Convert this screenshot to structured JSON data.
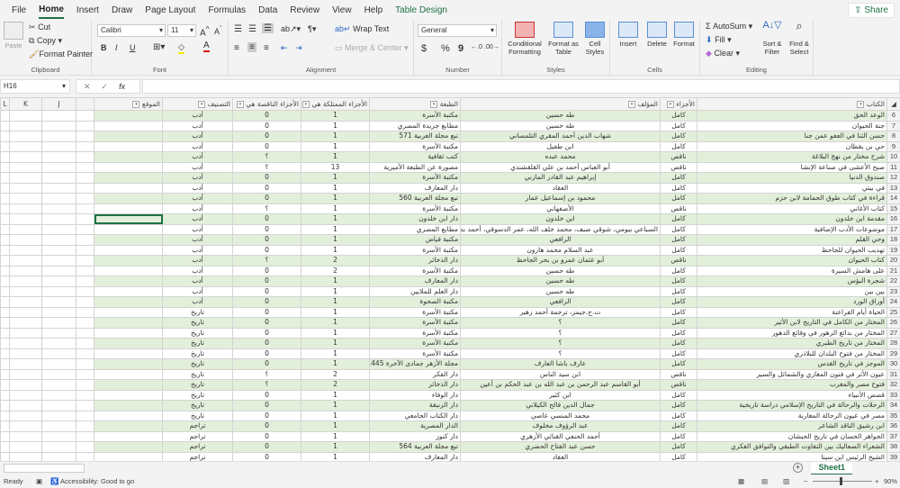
{
  "menu": {
    "tabs": [
      "File",
      "Home",
      "Insert",
      "Draw",
      "Page Layout",
      "Formulas",
      "Data",
      "Review",
      "View",
      "Help",
      "Table Design"
    ],
    "share": "Share"
  },
  "ribbon": {
    "clipboard": {
      "paste": "Paste",
      "cut": "Cut",
      "copy": "Copy",
      "format_painter": "Format Painter",
      "label": "Clipboard"
    },
    "font": {
      "name": "Calibri",
      "size": "11",
      "bold": "B",
      "italic": "I",
      "underline": "U",
      "label": "Font"
    },
    "alignment": {
      "wrap": "Wrap Text",
      "merge": "Merge & Center",
      "label": "Alignment"
    },
    "number": {
      "format": "General",
      "currency": "$",
      "percent": "%",
      "comma": "9",
      "label": "Number"
    },
    "styles": {
      "conditional": "Conditional Formatting",
      "format_table": "Format as Table",
      "cell_styles": "Cell Styles",
      "label": "Styles"
    },
    "cells": {
      "insert": "Insert",
      "delete": "Delete",
      "format": "Format",
      "label": "Cells"
    },
    "editing": {
      "autosum": "AutoSum",
      "fill": "Fill",
      "clear": "Clear",
      "sort": "Sort & Filter",
      "find": "Find & Select",
      "label": "Editing"
    }
  },
  "formula_bar": {
    "name_box": "H16",
    "fx": "fx",
    "value": ""
  },
  "sheet": {
    "extra_cols": [
      "L",
      "K",
      "J"
    ],
    "headers": [
      "الكتاب",
      "الأجزاء",
      "المؤلف",
      "الطبعة",
      "الأجزاء الممتلكة هي",
      "الأجزاء الناقصة هي",
      "التصنيف",
      "الموقع"
    ],
    "selected_row": 16,
    "rows": [
      {
        "n": 6,
        "c": [
          "الوعد الحق",
          "كامل",
          "طه حسين",
          "مكتبة الأسرة",
          "1",
          "0",
          "أدب"
        ]
      },
      {
        "n": 7,
        "c": [
          "جنة الحيوان",
          "كامل",
          "طه حسين",
          "مطابع جريدة المصري",
          "1",
          "0",
          "أدب"
        ]
      },
      {
        "n": 8,
        "c": [
          "حسن الثنا في العفو عمن جنا",
          "كامل",
          "شهاب الدين أحمد المقري التلمساني",
          "تبع مجلة العربية 571",
          "1",
          "0",
          "أدب"
        ]
      },
      {
        "n": 9,
        "c": [
          "حي بن يقظان",
          "كامل",
          "ابن طفيل",
          "مكتبة الأسرة",
          "1",
          "0",
          "أدب"
        ]
      },
      {
        "n": 10,
        "c": [
          "شرح مختار من نهج البلاغة",
          "ناقص",
          "محمد عبده",
          "كتب ثقافية",
          "1",
          "؟",
          "أدب"
        ]
      },
      {
        "n": 11,
        "c": [
          "صبح الأعشى في صناعة الإنشا",
          "ناقص",
          "أبو العباس أحمد بن علي القلقشندي",
          "مصورة عن الطبعة الأميرية",
          "13",
          "؟",
          "أدب"
        ]
      },
      {
        "n": 12,
        "c": [
          "صندوق الدنيا",
          "كامل",
          "إبراهيم عبد القادر المازني",
          "مكتبة الأسرة",
          "1",
          "0",
          "أدب"
        ]
      },
      {
        "n": 13,
        "c": [
          "في بيتي",
          "كامل",
          "العقاد",
          "دار المعارف",
          "1",
          "0",
          "أدب"
        ]
      },
      {
        "n": 14,
        "c": [
          "قراءة في كتاب طوق الحمامة لابن حزم",
          "كامل",
          "محمود بن إسماعيل عمار",
          "تبع مجلة العربية 560",
          "1",
          "0",
          "أدب"
        ]
      },
      {
        "n": 15,
        "c": [
          "كتاب الأغاني",
          "ناقص",
          "الأصفهاني",
          "مكتبة الأسرة",
          "1",
          "؟",
          "أدب"
        ]
      },
      {
        "n": 16,
        "c": [
          "مقدمة ابن خلدون",
          "كامل",
          "ابن خلدون",
          "دار ابن خلدون",
          "1",
          "0",
          "أدب"
        ]
      },
      {
        "n": 17,
        "c": [
          "موضوعات الأدب الإضافية",
          "كامل",
          "السباعي بيومي، شوقي ضيف، محمد خلف الله، عمر الدسوقي، أحمد بدوي",
          "مطابع المصري",
          "1",
          "0",
          "أدب"
        ]
      },
      {
        "n": 18,
        "c": [
          "وحي القلم",
          "كامل",
          "الرافعي",
          "مكتبة فياض",
          "1",
          "0",
          "أدب"
        ]
      },
      {
        "n": 19,
        "c": [
          "تهذيب الحيوان للجاحظ",
          "كامل",
          "عبد السلام محمد هارون",
          "مكتبة الأسرة",
          "1",
          "0",
          "أدب"
        ]
      },
      {
        "n": 20,
        "c": [
          "كتاب الحيوان",
          "ناقص",
          "أبو عثمان عمرو بن بحر الجاحظ",
          "دار الذخائر",
          "2",
          "؟",
          "أدب"
        ]
      },
      {
        "n": 21,
        "c": [
          "على هامش السيرة",
          "كامل",
          "طه حسين",
          "مكتبة الأسرة",
          "2",
          "0",
          "أدب"
        ]
      },
      {
        "n": 22,
        "c": [
          "شجرة البؤس",
          "كامل",
          "طه حسين",
          "دار المعارف",
          "1",
          "0",
          "أدب"
        ]
      },
      {
        "n": 23,
        "c": [
          "بين بين",
          "كامل",
          "طه حسين",
          "دار العلم للملايين",
          "1",
          "0",
          "أدب"
        ]
      },
      {
        "n": 24,
        "c": [
          "أوراق الورد",
          "كامل",
          "الرافعي",
          "مكتبة الصحوة",
          "1",
          "0",
          "أدب"
        ]
      },
      {
        "n": 25,
        "c": [
          "الحياة أيام الفراعنة",
          "كامل",
          "ت.ج.جيمز، ترجمة أحمد زهير",
          "مكتبة الأسرة",
          "1",
          "0",
          "تاريخ"
        ]
      },
      {
        "n": 26,
        "c": [
          "المختار من الكامل في التاريخ لابن الأثير",
          "كامل",
          "؟",
          "مكتبة الأسرة",
          "1",
          "0",
          "تاريخ"
        ]
      },
      {
        "n": 27,
        "c": [
          "المختار من بدائع الزهور في وقائع الدهور",
          "كامل",
          "؟",
          "مكتبة الأسرة",
          "1",
          "0",
          "تاريخ"
        ]
      },
      {
        "n": 28,
        "c": [
          "المختار من تاريخ الطبري",
          "كامل",
          "؟",
          "مكتبة الأسرة",
          "1",
          "0",
          "تاريخ"
        ]
      },
      {
        "n": 29,
        "c": [
          "المختار من فتوح البلدان للبلاذري",
          "كامل",
          "؟",
          "مكتبة الأسرة",
          "1",
          "0",
          "تاريخ"
        ]
      },
      {
        "n": 30,
        "c": [
          "الموجز في تاريخ القدس",
          "كامل",
          "عارف باشا العارف",
          "مجلة الأزهر جمادى الآخرة 1445",
          "1",
          "0",
          "تاريخ"
        ]
      },
      {
        "n": 31,
        "c": [
          "عيون الأثر في فنون المغازي والشمائل والسير",
          "ناقص",
          "ابن سيد الناس",
          "دار الفكر",
          "2",
          "؟",
          "تاريخ"
        ]
      },
      {
        "n": 32,
        "c": [
          "فتوح مصر والمغرب",
          "ناقص",
          "أبو القاسم عبد الرحمن بن عبد الله بن عبد الحكم بن أعين",
          "دار الذخائر",
          "2",
          "؟",
          "تاريخ"
        ]
      },
      {
        "n": 33,
        "c": [
          "قصص الأنبياء",
          "كامل",
          "ابن كثير",
          "دار الوفاء",
          "1",
          "0",
          "تاريخ"
        ]
      },
      {
        "n": 34,
        "c": [
          "الرحلات والرحالة في التاريخ الإسلامي دراسة تاريخية",
          "كامل",
          "جمال الدين فالح الكيلاني",
          "دار الزنبقة",
          "1",
          "0",
          "تاريخ"
        ]
      },
      {
        "n": 35,
        "c": [
          "مصر في عيون الرحالة المغاربة",
          "كامل",
          "محمد المنسي عاصي",
          "دار الكتاب الجامعي",
          "1",
          "0",
          "تاريخ"
        ]
      },
      {
        "n": 36,
        "c": [
          "ابن رشيق الناقد الشاعر",
          "كامل",
          "عبد الرؤوف مخلوف",
          "الدار المصرية",
          "1",
          "0",
          "تراجم"
        ]
      },
      {
        "n": 37,
        "c": [
          "الجواهر الحسان في تاريخ الحبشان",
          "كامل",
          "أحمد الحنفي القنائي الأزهري",
          "دار كنوز",
          "1",
          "0",
          "تراجم"
        ]
      },
      {
        "n": 38,
        "c": [
          "الشعراء الصعاليك بين التفاوت الطبقي والتوافق الفكري",
          "كامل",
          "حسن عبد الفتاح الحضري",
          "تبع مجلة العربية 564",
          "1",
          "0",
          "تراجم"
        ]
      },
      {
        "n": 39,
        "c": [
          "الشيخ الرئيس ابن سينا",
          "كامل",
          "العقاد",
          "دار المعارف",
          "1",
          "0",
          "تراجم"
        ]
      }
    ]
  },
  "sheet_tabs": {
    "active": "Sheet1",
    "add": "+"
  },
  "status": {
    "ready": "Ready",
    "accessibility": "Accessibility: Good to go",
    "zoom": "90%"
  },
  "colors": {
    "accent": "#1e7145",
    "band": "#e2efda"
  }
}
